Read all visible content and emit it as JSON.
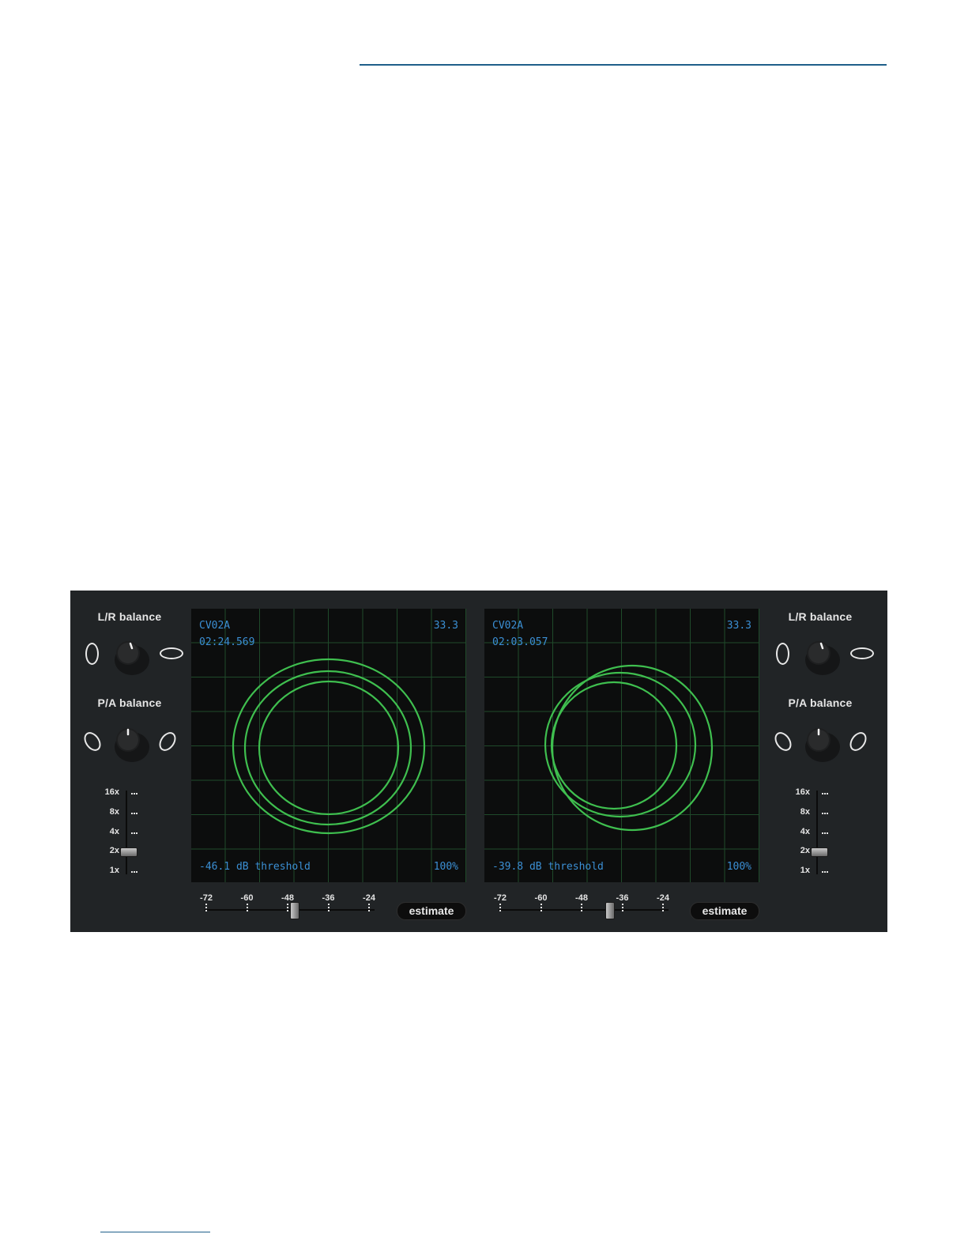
{
  "colors": {
    "panel_bg": "#212426",
    "screen_bg": "#0c0d0d",
    "grid_line": "#1f4a2a",
    "trace": "#3fbf4f",
    "readout_text": "#3b8fd4",
    "rule": "#1f5f8a"
  },
  "decks": [
    {
      "name": "CV02A",
      "time": "02:24.569",
      "speed": "33.3",
      "threshold": "-46.1 dB threshold",
      "percent": "100%",
      "threshold_db": -46.1,
      "estimate_label": "estimate"
    },
    {
      "name": "CV02A",
      "time": "02:03.057",
      "speed": "33.3",
      "threshold": "-39.8 dB threshold",
      "percent": "100%",
      "threshold_db": -39.8,
      "estimate_label": "estimate"
    }
  ],
  "side_controls": {
    "lr_label": "L/R balance",
    "pa_label": "P/A balance",
    "scale_labels": [
      "16x",
      "8x",
      "4x",
      "2x",
      "1x"
    ],
    "scale_value": "2x"
  },
  "threshold_scale": [
    "-72",
    "-60",
    "-48",
    "-36",
    "-24"
  ],
  "icons": {
    "lr_left": "vertical-ellipse-icon",
    "lr_right": "horizontal-ellipse-icon",
    "pa_left": "tilted-ellipse-left-icon",
    "pa_right": "tilted-ellipse-right-icon",
    "knob": "rotary-knob-icon"
  }
}
